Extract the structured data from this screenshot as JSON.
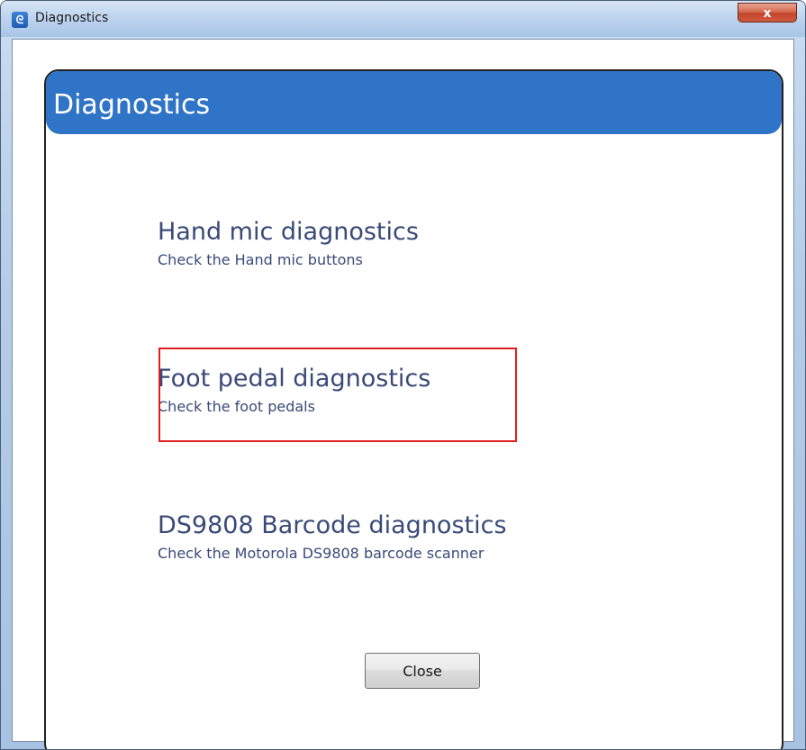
{
  "window": {
    "title": "Diagnostics",
    "close_glyph": "x"
  },
  "header": {
    "title": "Diagnostics"
  },
  "options": [
    {
      "title": "Hand mic diagnostics",
      "description": "Check the Hand mic buttons"
    },
    {
      "title": "Foot pedal diagnostics",
      "description": "Check the foot pedals"
    },
    {
      "title": "DS9808 Barcode diagnostics",
      "description": "Check the Motorola DS9808 barcode scanner"
    }
  ],
  "buttons": {
    "close_label": "Close"
  },
  "colors": {
    "header_blue": "#2f74c6",
    "option_text": "#3a4a78",
    "highlight_red": "#e02020"
  },
  "icons": {
    "app": "app-logo-icon"
  }
}
